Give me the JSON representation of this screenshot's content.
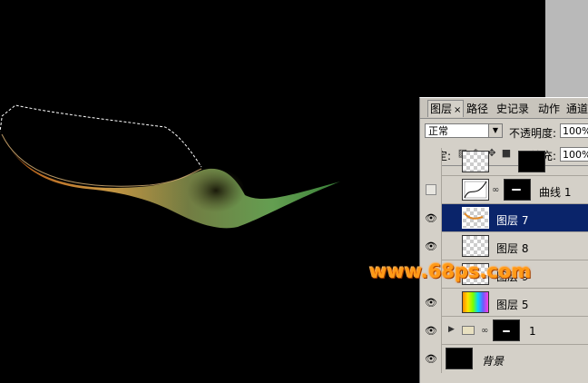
{
  "watermark": "www.68ps.com",
  "panel": {
    "tabs": [
      {
        "label": "图层",
        "close": "×",
        "active": true
      },
      {
        "label": "路径"
      },
      {
        "label": "历史记录",
        "visible_text": "史记录"
      },
      {
        "label": "动作"
      },
      {
        "label": "通道"
      }
    ],
    "blend_mode": "正常",
    "opacity_label": "不透明度:",
    "opacity_value": "100%",
    "lock_label": "锁定:",
    "fill_label": "填充:",
    "fill_value": "100%",
    "layers": [
      {
        "name": "曲线 1",
        "visible": false,
        "type": "adjustment"
      },
      {
        "name": "图层 7",
        "visible": true,
        "selected": true
      },
      {
        "name": "图层 8",
        "visible": true
      },
      {
        "name": "图层 9",
        "visible": false
      },
      {
        "name": "图层 5",
        "visible": true,
        "type": "rainbow"
      },
      {
        "name": "1",
        "visible": true,
        "type": "group"
      },
      {
        "name": "背景",
        "visible": true,
        "type": "background"
      }
    ]
  },
  "icons": {
    "eye": "eye-icon",
    "link": "link-icon",
    "lock": "lock-icon",
    "folder": "folder-icon"
  },
  "colors": {
    "canvas_bg": "#000000",
    "selection_bg": "#0a246a",
    "watermark": "#ff9a17"
  }
}
